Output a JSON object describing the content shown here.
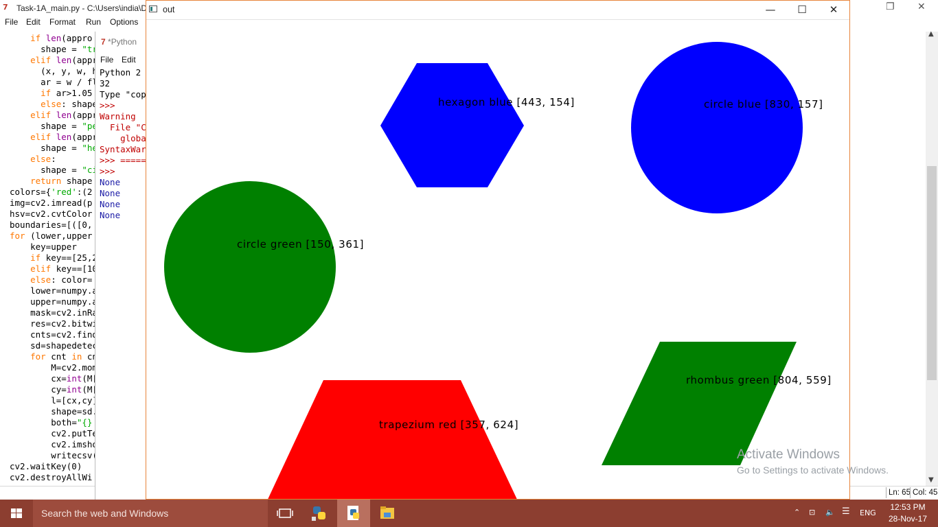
{
  "editor": {
    "title": "Task-1A_main.py - C:\\Users\\india\\D",
    "menu": [
      "File",
      "Edit",
      "Format",
      "Run",
      "Options"
    ],
    "code_lines": [
      {
        "indent": "    ",
        "parts": [
          [
            "kw",
            "if "
          ],
          [
            "bi",
            "len"
          ],
          [
            "",
            "(appro"
          ]
        ]
      },
      {
        "indent": "      ",
        "parts": [
          [
            "",
            "shape = "
          ],
          [
            "st",
            "\"tr"
          ]
        ]
      },
      {
        "indent": "    ",
        "parts": [
          [
            "kw",
            "elif "
          ],
          [
            "bi",
            "len"
          ],
          [
            "",
            "(appr"
          ]
        ]
      },
      {
        "indent": "      ",
        "parts": [
          [
            "",
            "(x, y, w, h"
          ]
        ]
      },
      {
        "indent": "      ",
        "parts": [
          [
            "",
            "ar = w / fl"
          ]
        ]
      },
      {
        "indent": "      ",
        "parts": [
          [
            "kw",
            "if "
          ],
          [
            "",
            "ar>1.05"
          ]
        ]
      },
      {
        "indent": "      ",
        "parts": [
          [
            "kw",
            "else"
          ],
          [
            "",
            ": shape"
          ]
        ]
      },
      {
        "indent": "    ",
        "parts": [
          [
            "kw",
            "elif "
          ],
          [
            "bi",
            "len"
          ],
          [
            "",
            "(appr"
          ]
        ]
      },
      {
        "indent": "      ",
        "parts": [
          [
            "",
            "shape = "
          ],
          [
            "st",
            "\"pe"
          ]
        ]
      },
      {
        "indent": "    ",
        "parts": [
          [
            "kw",
            "elif "
          ],
          [
            "bi",
            "len"
          ],
          [
            "",
            "(appr"
          ]
        ]
      },
      {
        "indent": "      ",
        "parts": [
          [
            "",
            "shape = "
          ],
          [
            "st",
            "\"he"
          ]
        ]
      },
      {
        "indent": "    ",
        "parts": [
          [
            "kw",
            "else"
          ],
          [
            "",
            ":"
          ]
        ]
      },
      {
        "indent": "      ",
        "parts": [
          [
            "",
            "shape = "
          ],
          [
            "st",
            "\"ci"
          ]
        ]
      },
      {
        "indent": "    ",
        "parts": [
          [
            "kw",
            "return "
          ],
          [
            "",
            "shape"
          ]
        ]
      },
      {
        "indent": "",
        "parts": [
          [
            "",
            "colors={"
          ],
          [
            "st",
            "'red'"
          ],
          [
            "",
            ":(2"
          ]
        ]
      },
      {
        "indent": "",
        "parts": [
          [
            "",
            "img=cv2.imread(p"
          ]
        ]
      },
      {
        "indent": "",
        "parts": [
          [
            "",
            "hsv=cv2.cvtColor"
          ]
        ]
      },
      {
        "indent": "",
        "parts": [
          [
            "",
            "boundaries=[([0,"
          ]
        ]
      },
      {
        "indent": "",
        "parts": [
          [
            "kw",
            "for "
          ],
          [
            "",
            "(lower,upper"
          ]
        ]
      },
      {
        "indent": "    ",
        "parts": [
          [
            "",
            "key=upper"
          ]
        ]
      },
      {
        "indent": "    ",
        "parts": [
          [
            "kw",
            "if "
          ],
          [
            "",
            "key==[25,2"
          ]
        ]
      },
      {
        "indent": "    ",
        "parts": [
          [
            "kw",
            "elif "
          ],
          [
            "",
            "key==[10"
          ]
        ]
      },
      {
        "indent": "    ",
        "parts": [
          [
            "kw",
            "else"
          ],
          [
            "",
            ": color="
          ]
        ]
      },
      {
        "indent": "    ",
        "parts": [
          [
            "",
            "lower=numpy.a"
          ]
        ]
      },
      {
        "indent": "    ",
        "parts": [
          [
            "",
            "upper=numpy.a"
          ]
        ]
      },
      {
        "indent": "    ",
        "parts": [
          [
            "",
            "mask=cv2.inRa"
          ]
        ]
      },
      {
        "indent": "    ",
        "parts": [
          [
            "",
            "res=cv2.bitwi"
          ]
        ]
      },
      {
        "indent": "    ",
        "parts": [
          [
            "",
            "cnts=cv2.find"
          ]
        ]
      },
      {
        "indent": "    ",
        "parts": [
          [
            "",
            "sd=shapedetec"
          ]
        ]
      },
      {
        "indent": "    ",
        "parts": [
          [
            "kw",
            "for "
          ],
          [
            "",
            "cnt "
          ],
          [
            "kw",
            "in "
          ],
          [
            "",
            "cn"
          ]
        ]
      },
      {
        "indent": "        ",
        "parts": [
          [
            "",
            "M=cv2.mome"
          ]
        ]
      },
      {
        "indent": "        ",
        "parts": [
          [
            "",
            "cx="
          ],
          [
            "bi",
            "int"
          ],
          [
            "",
            "(M['"
          ]
        ]
      },
      {
        "indent": "        ",
        "parts": [
          [
            "",
            "cy="
          ],
          [
            "bi",
            "int"
          ],
          [
            "",
            "(M['"
          ]
        ]
      },
      {
        "indent": "        ",
        "parts": [
          [
            "",
            "l=[cx,cy]"
          ]
        ]
      },
      {
        "indent": "        ",
        "parts": [
          [
            "",
            "shape=sd.d"
          ]
        ]
      },
      {
        "indent": "        ",
        "parts": [
          [
            "",
            "both="
          ],
          [
            "st",
            "\"{} {"
          ]
        ]
      },
      {
        "indent": "        ",
        "parts": [
          [
            "",
            "cv2.putTex"
          ]
        ]
      },
      {
        "indent": "        ",
        "parts": [
          [
            "",
            "cv2.imshow"
          ]
        ]
      },
      {
        "indent": "        ",
        "parts": [
          [
            "",
            "writecsv(c"
          ]
        ]
      },
      {
        "indent": "",
        "parts": [
          [
            "",
            "cv2.waitKey(0)"
          ]
        ]
      },
      {
        "indent": "",
        "parts": [
          [
            "",
            "cv2.destroyAllWi"
          ]
        ]
      }
    ],
    "status_ln": "Ln: 65",
    "status_col": "Col: 45"
  },
  "shell": {
    "title": "*Python",
    "menu": [
      "File",
      "Edit"
    ],
    "lines": [
      {
        "text": "Python 2",
        "color": "#000000"
      },
      {
        "text": "32",
        "color": "#000000"
      },
      {
        "text": "Type \"cop",
        "color": "#000000"
      },
      {
        "text": ">>>",
        "color": "#c00000"
      },
      {
        "text": "Warning",
        "color": "#c00000"
      },
      {
        "text": "  File \"C",
        "color": "#c00000"
      },
      {
        "text": "    globa",
        "color": "#c00000"
      },
      {
        "text": "SyntaxWar",
        "color": "#c00000"
      },
      {
        "text": ">>> =====",
        "color": "#c00000"
      },
      {
        "text": ">>>",
        "color": "#c00000"
      },
      {
        "text": "None",
        "color": "#1a1aa6"
      },
      {
        "text": "None",
        "color": "#1a1aa6"
      },
      {
        "text": "None",
        "color": "#1a1aa6"
      },
      {
        "text": "None",
        "color": "#1a1aa6"
      }
    ]
  },
  "out_window": {
    "title": "out",
    "minimize": "—",
    "maximize": "☐",
    "close": "✕",
    "shapes": [
      {
        "name": "hexagon",
        "color": "#0000ff",
        "label": "hexagon blue [443, 154]"
      },
      {
        "name": "circle",
        "color": "#0000ff",
        "label": "circle blue [830, 157]"
      },
      {
        "name": "circle",
        "color": "#008000",
        "label": "circle green [150, 361]"
      },
      {
        "name": "rhombus",
        "color": "#008000",
        "label": "rhombus green [804, 559]"
      },
      {
        "name": "trapezium",
        "color": "#ff0000",
        "label": "trapezium red [357, 624]"
      }
    ]
  },
  "watermark": {
    "line1": "Activate Windows",
    "line2": "Go to Settings to activate Windows."
  },
  "taskbar": {
    "search_placeholder": "Search the web and Windows",
    "language": "ENG",
    "time": "12:53 PM",
    "date": "28-Nov-17",
    "accent": "#8c3e30"
  }
}
